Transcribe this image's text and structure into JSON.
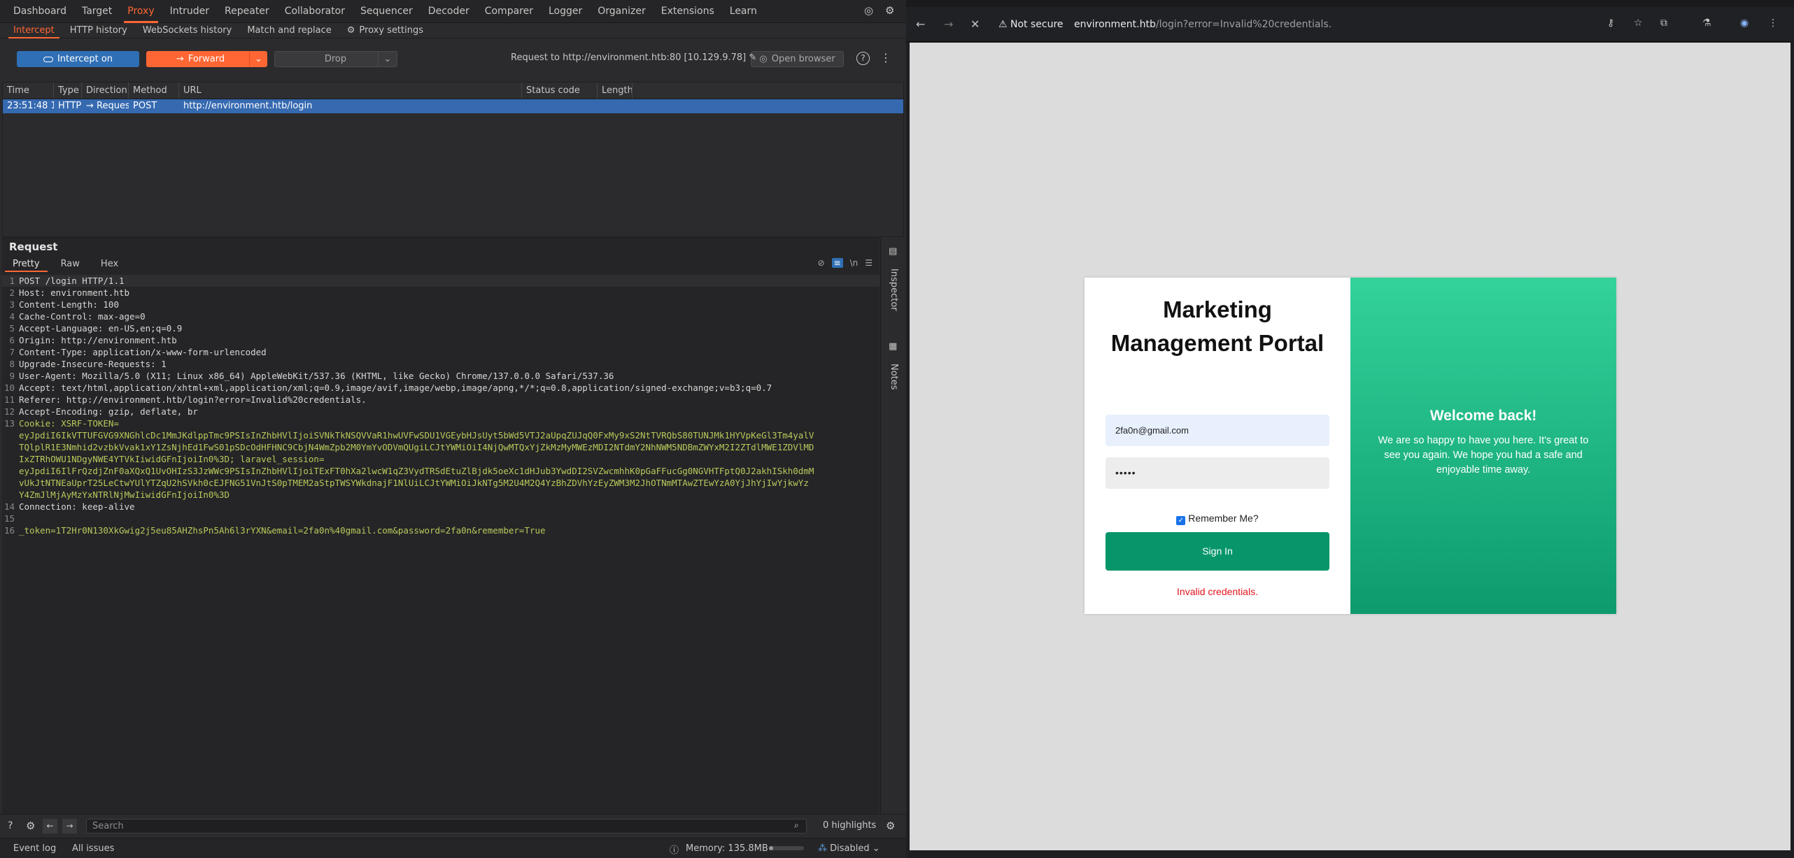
{
  "burp": {
    "top_tabs": [
      "Dashboard",
      "Target",
      "Proxy",
      "Intruder",
      "Repeater",
      "Collaborator",
      "Sequencer",
      "Decoder",
      "Comparer",
      "Logger",
      "Organizer",
      "Extensions",
      "Learn"
    ],
    "sub_tabs": [
      "Intercept",
      "HTTP history",
      "WebSockets history",
      "Match and replace",
      "Proxy settings"
    ],
    "intercept_label": "Intercept on",
    "forward_label": "Forward",
    "drop_label": "Drop",
    "request_to": "Request to http://environment.htb:80  [10.129.9.78]",
    "open_browser": "Open browser",
    "columns": [
      "Time",
      "Type",
      "Direction",
      "Method",
      "URL",
      "Status code",
      "Length"
    ],
    "row": {
      "time": "23:51:48 1...",
      "type": "HTTP",
      "direction": "→  Request",
      "method": "POST",
      "url": "http://environment.htb/login",
      "status": "",
      "length": ""
    },
    "request_title": "Request",
    "editor_tabs": [
      "Pretty",
      "Raw",
      "Hex"
    ],
    "lines": [
      {
        "n": "1",
        "t": "POST /login HTTP/1.1"
      },
      {
        "n": "2",
        "t": "Host: environment.htb"
      },
      {
        "n": "3",
        "t": "Content-Length: 100"
      },
      {
        "n": "4",
        "t": "Cache-Control: max-age=0"
      },
      {
        "n": "5",
        "t": "Accept-Language: en-US,en;q=0.9"
      },
      {
        "n": "6",
        "t": "Origin: http://environment.htb"
      },
      {
        "n": "7",
        "t": "Content-Type: application/x-www-form-urlencoded"
      },
      {
        "n": "8",
        "t": "Upgrade-Insecure-Requests: 1"
      },
      {
        "n": "9",
        "t": "User-Agent: Mozilla/5.0 (X11; Linux x86_64) AppleWebKit/537.36 (KHTML, like Gecko) Chrome/137.0.0.0 Safari/537.36"
      },
      {
        "n": "10",
        "t": "Accept: text/html,application/xhtml+xml,application/xml;q=0.9,image/avif,image/webp,image/apng,*/*;q=0.8,application/signed-exchange;v=b3;q=0.7"
      },
      {
        "n": "11",
        "t": "Referer: http://environment.htb/login?error=Invalid%20credentials."
      },
      {
        "n": "12",
        "t": "Accept-Encoding: gzip, deflate, br"
      },
      {
        "n": "13",
        "t": "Cookie: XSRF-TOKEN="
      },
      {
        "n": "",
        "t": "eyJpdiI6IkVTTUFGVG9XNGhlcDc1MmJKdlppTmc9PSIsInZhbHVlIjoiSVNkTkNSQVVaR1hwUVFwSDU1VGEybHJsUyt5bWd5VTJ2aUpqZUJqQ0FxMy9xS2NtTVRQbS80TUNJMk1HYVpKeGl3Tm4yalV"
      },
      {
        "n": "",
        "t": "TQlplR1E3Nmhid2vzbkVvak1xY1ZsNjhEd1FwS01pSDcOdHFHNC9CbjN4WmZpb2M0YmYvODVmQUgiLCJtYWMiOiI4NjQwMTQxYjZkMzMyMWEzMDI2NTdmY2NhNWM5NDBmZWYxM2I2ZTdlMWE1ZDVlMD"
      },
      {
        "n": "",
        "t": "IxZTRhOWU1NDgyNWE4YTVkIiwidGFnIjoiIn0%3D; laravel_session="
      },
      {
        "n": "",
        "t": "eyJpdiI6IlFrQzdjZnF0aXQxQ1UvOHIzS3JzWWc9PSIsInZhbHVlIjoiTExFT0hXa2lwcW1qZ3VydTRSdEtuZlBjdk5oeXc1dHJub3YwdDI2SVZwcmhhK0pGaFFucGg0NGVHTFptQ0J2akhISkh0dmM"
      },
      {
        "n": "",
        "t": "vUkJtNTNEaUprT25LeCtwYUlYTZqU2hSVkh0cEJFNG51VnJtS0pTMEM2aStpTWSYWkdnajF1NlUiLCJtYWMiOiJkNTg5M2U4M2Q4YzBhZDVhYzEyZWM3M2JhOTNmMTAwZTEwYzA0YjJhYjIwYjkwYz"
      },
      {
        "n": "",
        "t": "Y4ZmJlMjAyMzYxNTRlNjMwIiwidGFnIjoiIn0%3D"
      },
      {
        "n": "14",
        "t": "Connection: keep-alive"
      },
      {
        "n": "15",
        "t": ""
      },
      {
        "n": "16",
        "t": "_token=1T2Hr0N130XkGwig2j5eu85AHZhsPn5Ah6l3rYXN&email=2fa0n%40gmail.com&password=2fa0n&remember=True"
      }
    ],
    "sidebar_inspector": "Inspector",
    "sidebar_notes": "Notes",
    "search_placeholder": "Search",
    "highlights": "0 highlights",
    "event_log": "Event log",
    "all_issues": "All issues",
    "memory": "Memory: 135.8MB",
    "disabled": "Disabled"
  },
  "browser": {
    "not_secure": "Not secure",
    "url_host": "environment.htb",
    "url_rest": "/login?error=Invalid%20credentials.",
    "page_title": "Marketing Management Portal",
    "email_value": "2fa0n@gmail.com",
    "password_value": "•••••",
    "remember_label": "Remember Me?",
    "signin_label": "Sign In",
    "error_text": "Invalid credentials.",
    "welcome_title": "Welcome back!",
    "welcome_text": "We are so happy to have you here. It's great to see you again. We hope you had a safe and enjoyable time away."
  },
  "colors": {
    "burp_accent": "#ff6633",
    "intercept_blue": "#2f6fb5",
    "selected_row": "#3569b0",
    "signin_green": "#07966a",
    "error_red": "#e3141c"
  }
}
